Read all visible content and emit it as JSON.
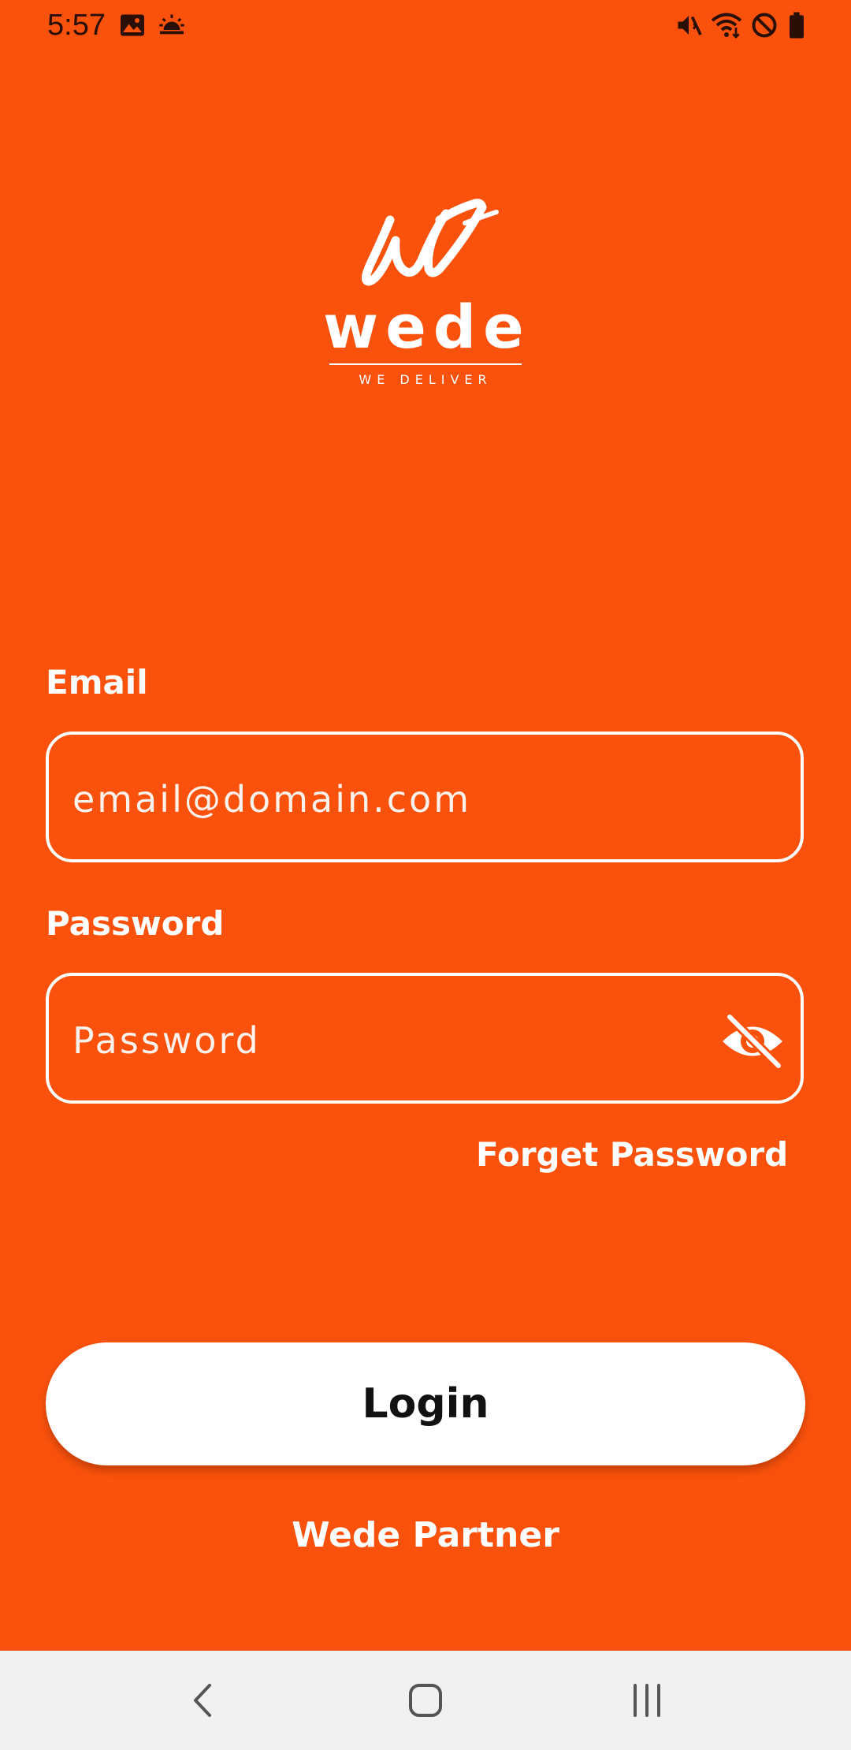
{
  "status_bar": {
    "time": "5:57",
    "icons": [
      "gallery-icon",
      "weather-icon",
      "mute-icon",
      "wifi-icon",
      "do-not-disturb-icon",
      "battery-icon"
    ]
  },
  "logo": {
    "wordmark": "wede",
    "tagline": "WE DELIVER"
  },
  "form": {
    "email_label": "Email",
    "email_placeholder": "email@domain.com",
    "password_label": "Password",
    "password_placeholder": "Password",
    "forget_password": "Forget Password"
  },
  "actions": {
    "login": "Login",
    "partner": "Wede Partner"
  },
  "nav_bar": {
    "icons": [
      "back-icon",
      "home-icon",
      "recent-apps-icon"
    ]
  },
  "colors": {
    "background": "#FA520C",
    "button": "#FFFFFF",
    "nav_bar": "#F1F1F1"
  }
}
